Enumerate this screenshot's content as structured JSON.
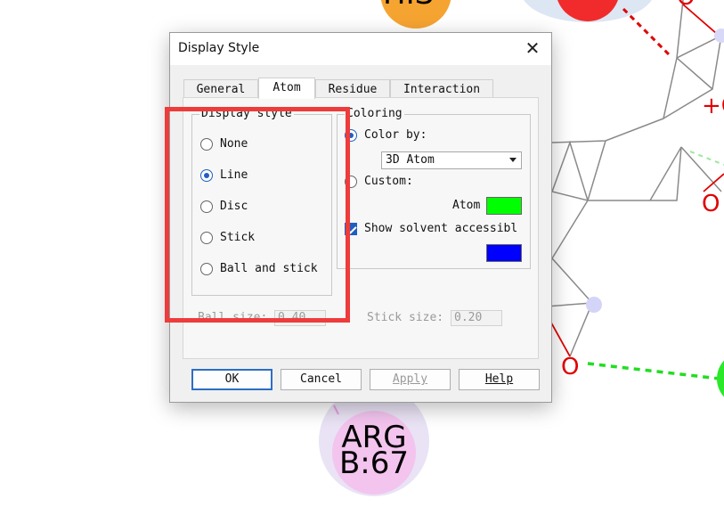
{
  "dialog": {
    "title": "Display Style",
    "close_glyph": "✕"
  },
  "tabs": [
    {
      "label": "General"
    },
    {
      "label": "Atom"
    },
    {
      "label": "Residue"
    },
    {
      "label": "Interaction"
    }
  ],
  "active_tab": "Atom",
  "display_style": {
    "legend": "Display style",
    "options": [
      {
        "label": "None",
        "checked": false
      },
      {
        "label": "Line",
        "checked": true
      },
      {
        "label": "Disc",
        "checked": false
      },
      {
        "label": "Stick",
        "checked": false
      },
      {
        "label": "Ball and stick",
        "checked": false
      }
    ]
  },
  "coloring": {
    "legend": "Coloring",
    "color_by_label": "Color by:",
    "color_by_checked": true,
    "color_by_value": "3D Atom",
    "custom_label": "Custom:",
    "custom_checked": false,
    "atom_label": "Atom",
    "atom_color": "#00ff00",
    "show_solvent_label": "Show solvent accessibl",
    "show_solvent_checked": true,
    "solvent_color": "#0000ff"
  },
  "sizes": {
    "ball_size_label": "Ball size:",
    "ball_size_value": "0.40",
    "stick_size_label": "Stick size:",
    "stick_size_value": "0.20"
  },
  "buttons": {
    "ok": "OK",
    "cancel": "Cancel",
    "apply": "Apply",
    "help": "Help"
  },
  "background": {
    "residue_label_line1": "ARG",
    "residue_label_line2": "B:67",
    "residue_top_partial": "HIS",
    "atom_o1": "O",
    "atom_o2": "O",
    "atom_o3": "O",
    "atom_plus": "+O"
  },
  "colors": {
    "highlight": "#ee3b3b",
    "accent": "#1f5fbf"
  }
}
